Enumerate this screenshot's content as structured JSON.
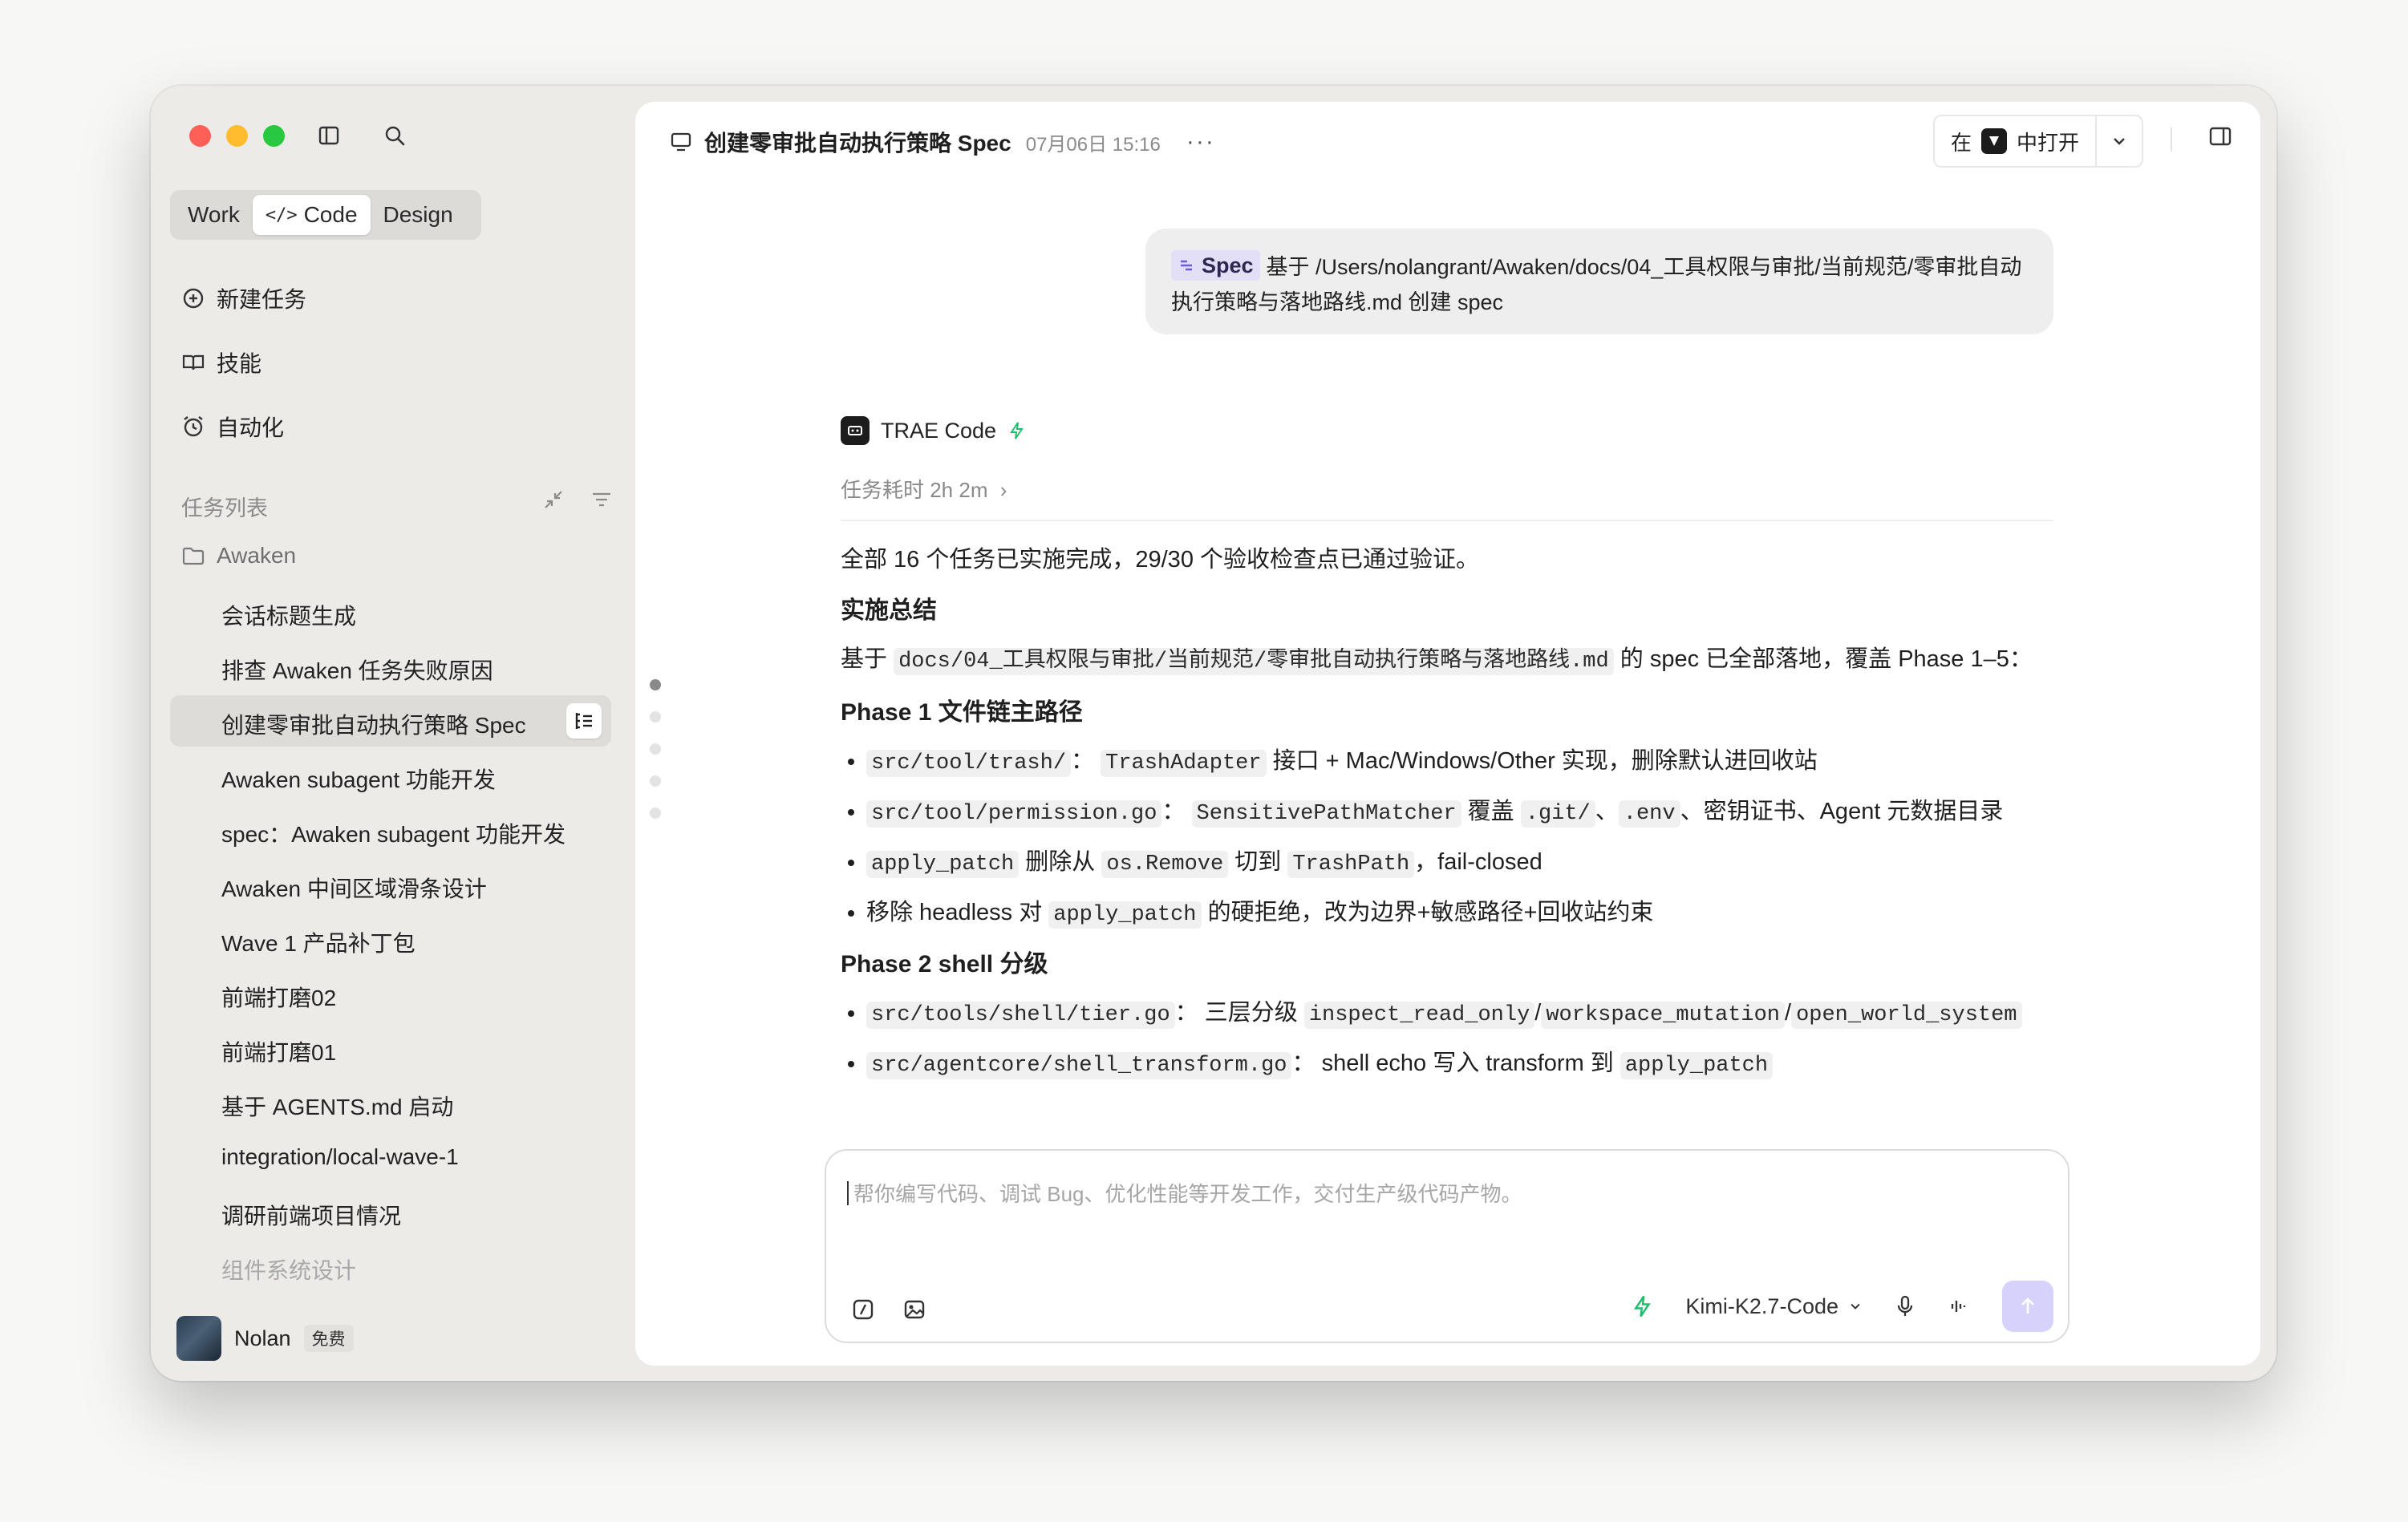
{
  "sidebar": {
    "modes": [
      "Work",
      "Code",
      "Design"
    ],
    "active_mode": "Code",
    "nav": {
      "new_task": "新建任务",
      "skills": "技能",
      "automation": "自动化"
    },
    "section_title": "任务列表",
    "folder": "Awaken",
    "tasks": [
      "会话标题生成",
      "排查 Awaken 任务失败原因",
      "创建零审批自动执行策略 Spec",
      "Awaken subagent 功能开发",
      "spec：Awaken subagent 功能开发",
      "Awaken 中间区域滑条设计",
      "Wave 1 产品补丁包",
      "前端打磨02",
      "前端打磨01",
      "基于 AGENTS.md 启动",
      "integration/local-wave-1",
      "调研前端项目情况",
      "组件系统设计"
    ],
    "user": {
      "name": "Nolan",
      "plan": "免费"
    }
  },
  "header": {
    "title": "创建零审批自动执行策略 Spec",
    "date": "07月06日 15:16",
    "more": "···",
    "open_in_prefix": "在",
    "open_in_suffix": "中打开"
  },
  "user_message": {
    "tag": "Spec",
    "text": "基于 /Users/nolangrant/Awaken/docs/04_工具权限与审批/当前规范/零审批自动执行策略与落地路线.md 创建 spec"
  },
  "reply": {
    "author": "TRAE Code",
    "elapsed": "任务耗时 2h 2m",
    "summary": "全部 16 个任务已实施完成，29/30 个验收检查点已通过验证。",
    "h_impl": "实施总结",
    "basis_pre": "基于",
    "basis_code": "docs/04_工具权限与审批/当前规范/零审批自动执行策略与落地路线.md",
    "basis_post": "的 spec 已全部落地，覆盖 Phase 1–5：",
    "phase1": "Phase 1 文件链主路径",
    "p1_items": [
      {
        "code1": "src/tool/trash/",
        "sep": "：",
        "code2": "TrashAdapter",
        "text": "接口 + Mac/Windows/Other 实现，删除默认进回收站"
      },
      {
        "code1": "src/tool/permission.go",
        "sep": "：",
        "code2": "SensitivePathMatcher",
        "t1": "覆盖",
        "code3": ".git/",
        "s2": "、",
        "code4": ".env",
        "t2": "、密钥证书、Agent 元数据目录"
      },
      {
        "code1": "apply_patch",
        "t1": "删除从",
        "code2": "os.Remove",
        "t2": "切到",
        "code3": "TrashPath",
        "t3": "，fail-closed"
      },
      {
        "t1": "移除 headless 对",
        "code1": "apply_patch",
        "t2": "的硬拒绝，改为边界+敏感路径+回收站约束"
      }
    ],
    "phase2": "Phase 2 shell 分级",
    "p2_items": [
      {
        "code1": "src/tools/shell/tier.go",
        "sep": "：",
        "t1": "三层分级",
        "code2": "inspect_read_only",
        "s1": "/",
        "code3": "workspace_mutation",
        "s2": "/",
        "code4": "open_world_system"
      },
      {
        "code1": "src/agentcore/shell_transform.go",
        "sep": "：",
        "t1": "shell echo 写入 transform 到",
        "code2": "apply_patch"
      }
    ]
  },
  "composer": {
    "placeholder": "帮你编写代码、调试 Bug、优化性能等开发工作，交付生产级代码产物。",
    "model": "Kimi-K2.7-Code"
  },
  "colors": {
    "accent": "#d6d2fb",
    "spec_tag_bg": "#e3dff7",
    "bolt": "#1fbf6e"
  }
}
